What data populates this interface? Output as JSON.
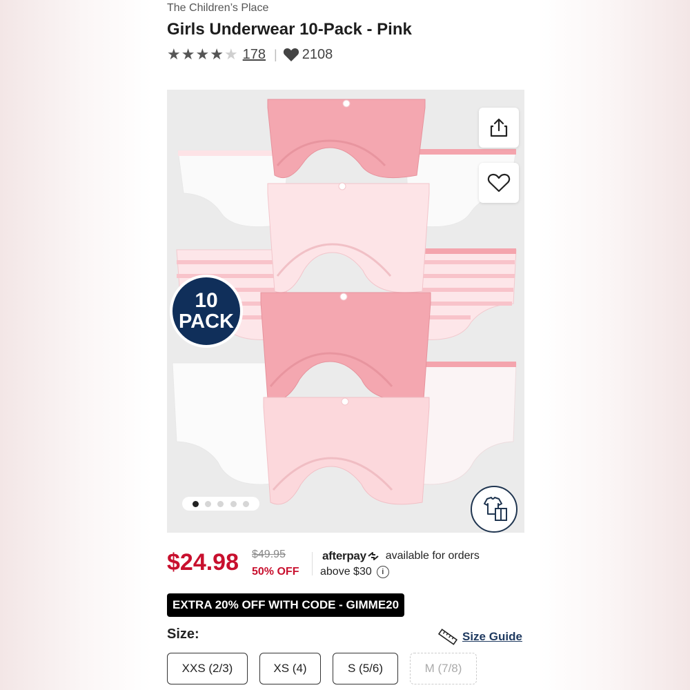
{
  "brand": "The Children’s Place",
  "product": {
    "title": "Girls Underwear 10-Pack - Pink",
    "rating": 4.5,
    "rating_max": 5,
    "review_count": "178",
    "likes": "2108"
  },
  "gallery": {
    "badge_number": "10",
    "badge_word": "PACK",
    "image_count": 5,
    "active_index": 0
  },
  "pricing": {
    "price": "$24.98",
    "original_price": "$49.95",
    "discount": "50% OFF",
    "afterpay_logo": "afterpay",
    "afterpay_line1": "available for orders",
    "afterpay_line2": "above $30",
    "info_symbol": "i"
  },
  "promo": "EXTRA 20% OFF WITH CODE - GIMME20",
  "size": {
    "label": "Size:",
    "guide_label": "Size Guide",
    "options": [
      {
        "label": "XXS (2/3)",
        "available": true
      },
      {
        "label": "XS (4)",
        "available": true
      },
      {
        "label": "S (5/6)",
        "available": true
      },
      {
        "label": "M (7/8)",
        "available": false
      }
    ]
  },
  "colors": {
    "price_red": "#c8102e",
    "badge_navy": "#102f5a",
    "link_navy": "#1f3a60",
    "brief_pink": "#f4a4ad",
    "brief_light_pink": "#fad4d8",
    "brief_white": "#ffffff"
  },
  "icons": {
    "share": "share-icon",
    "favorite": "heart-outline-icon",
    "likes": "heart-filled-icon",
    "try_on": "outfit-icon",
    "ruler": "ruler-icon",
    "info": "info-icon"
  }
}
